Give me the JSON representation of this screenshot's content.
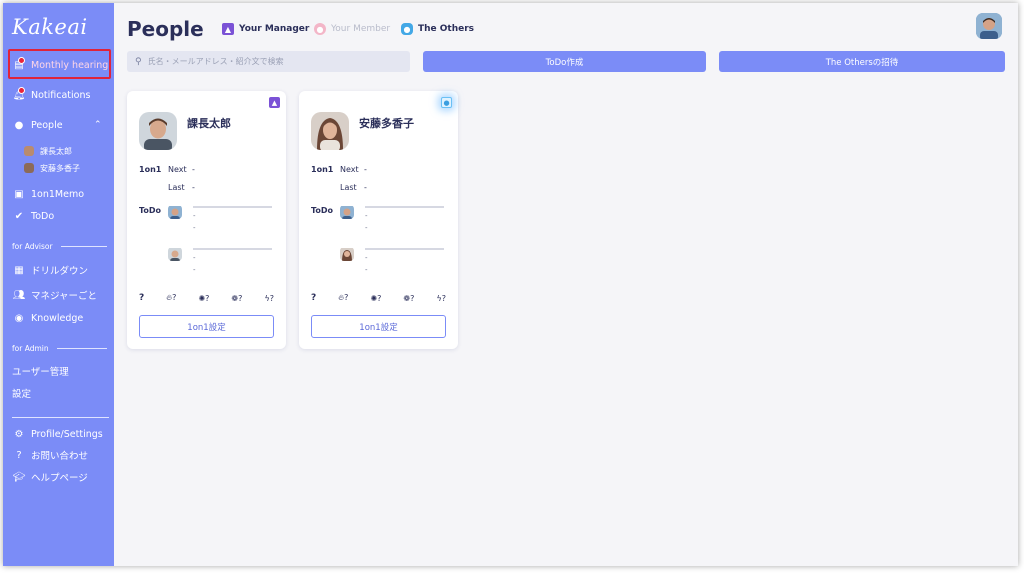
{
  "app": {
    "logo": "Kakeai"
  },
  "sidebar": {
    "hearing": "Monthly hearing",
    "notifications": "Notifications",
    "people": "People",
    "people_children": [
      "課長太郎",
      "安藤多香子"
    ],
    "memo": "1on1Memo",
    "todo": "ToDo",
    "advisor_section": "for Advisor",
    "drilldown": "ドリルダウン",
    "manager_each": "マネジャーごと",
    "knowledge": "Knowledge",
    "admin_section": "for Admin",
    "user_admin": "ユーザー管理",
    "settings": "設定",
    "profile": "Profile/Settings",
    "contact": "お問い合わせ",
    "help": "ヘルプページ"
  },
  "header": {
    "title": "People",
    "filters": [
      {
        "label": "Your Manager",
        "color": "#7b52d6",
        "active": true
      },
      {
        "label": "Your Member",
        "color": "#f3b6c8",
        "active": false
      },
      {
        "label": "The Others",
        "color": "#43a8e6",
        "active": true
      }
    ]
  },
  "toolbar": {
    "search_placeholder": "氏名・メールアドレス・紹介文で検索",
    "todo_button": "ToDo作成",
    "invite_button": "The Othersの招待"
  },
  "cards": [
    {
      "name": "課長太郎",
      "label_1on1": "1on1",
      "next_label": "Next",
      "next_value": "-",
      "last_label": "Last",
      "last_value": "-",
      "todo_label": "ToDo",
      "todo_dash": "-",
      "icon_values": [
        "?",
        "?",
        "?",
        "?",
        "?"
      ],
      "button": "1on1設定",
      "corner": "manager"
    },
    {
      "name": "安藤多香子",
      "label_1on1": "1on1",
      "next_label": "Next",
      "next_value": "-",
      "last_label": "Last",
      "last_value": "-",
      "todo_label": "ToDo",
      "todo_dash": "-",
      "icon_values": [
        "?",
        "?",
        "?",
        "?",
        "?"
      ],
      "button": "1on1設定",
      "corner": "others"
    }
  ],
  "colors": {
    "accent": "#7b8cf7",
    "title": "#2b2f5a",
    "alert": "#e8243b"
  }
}
